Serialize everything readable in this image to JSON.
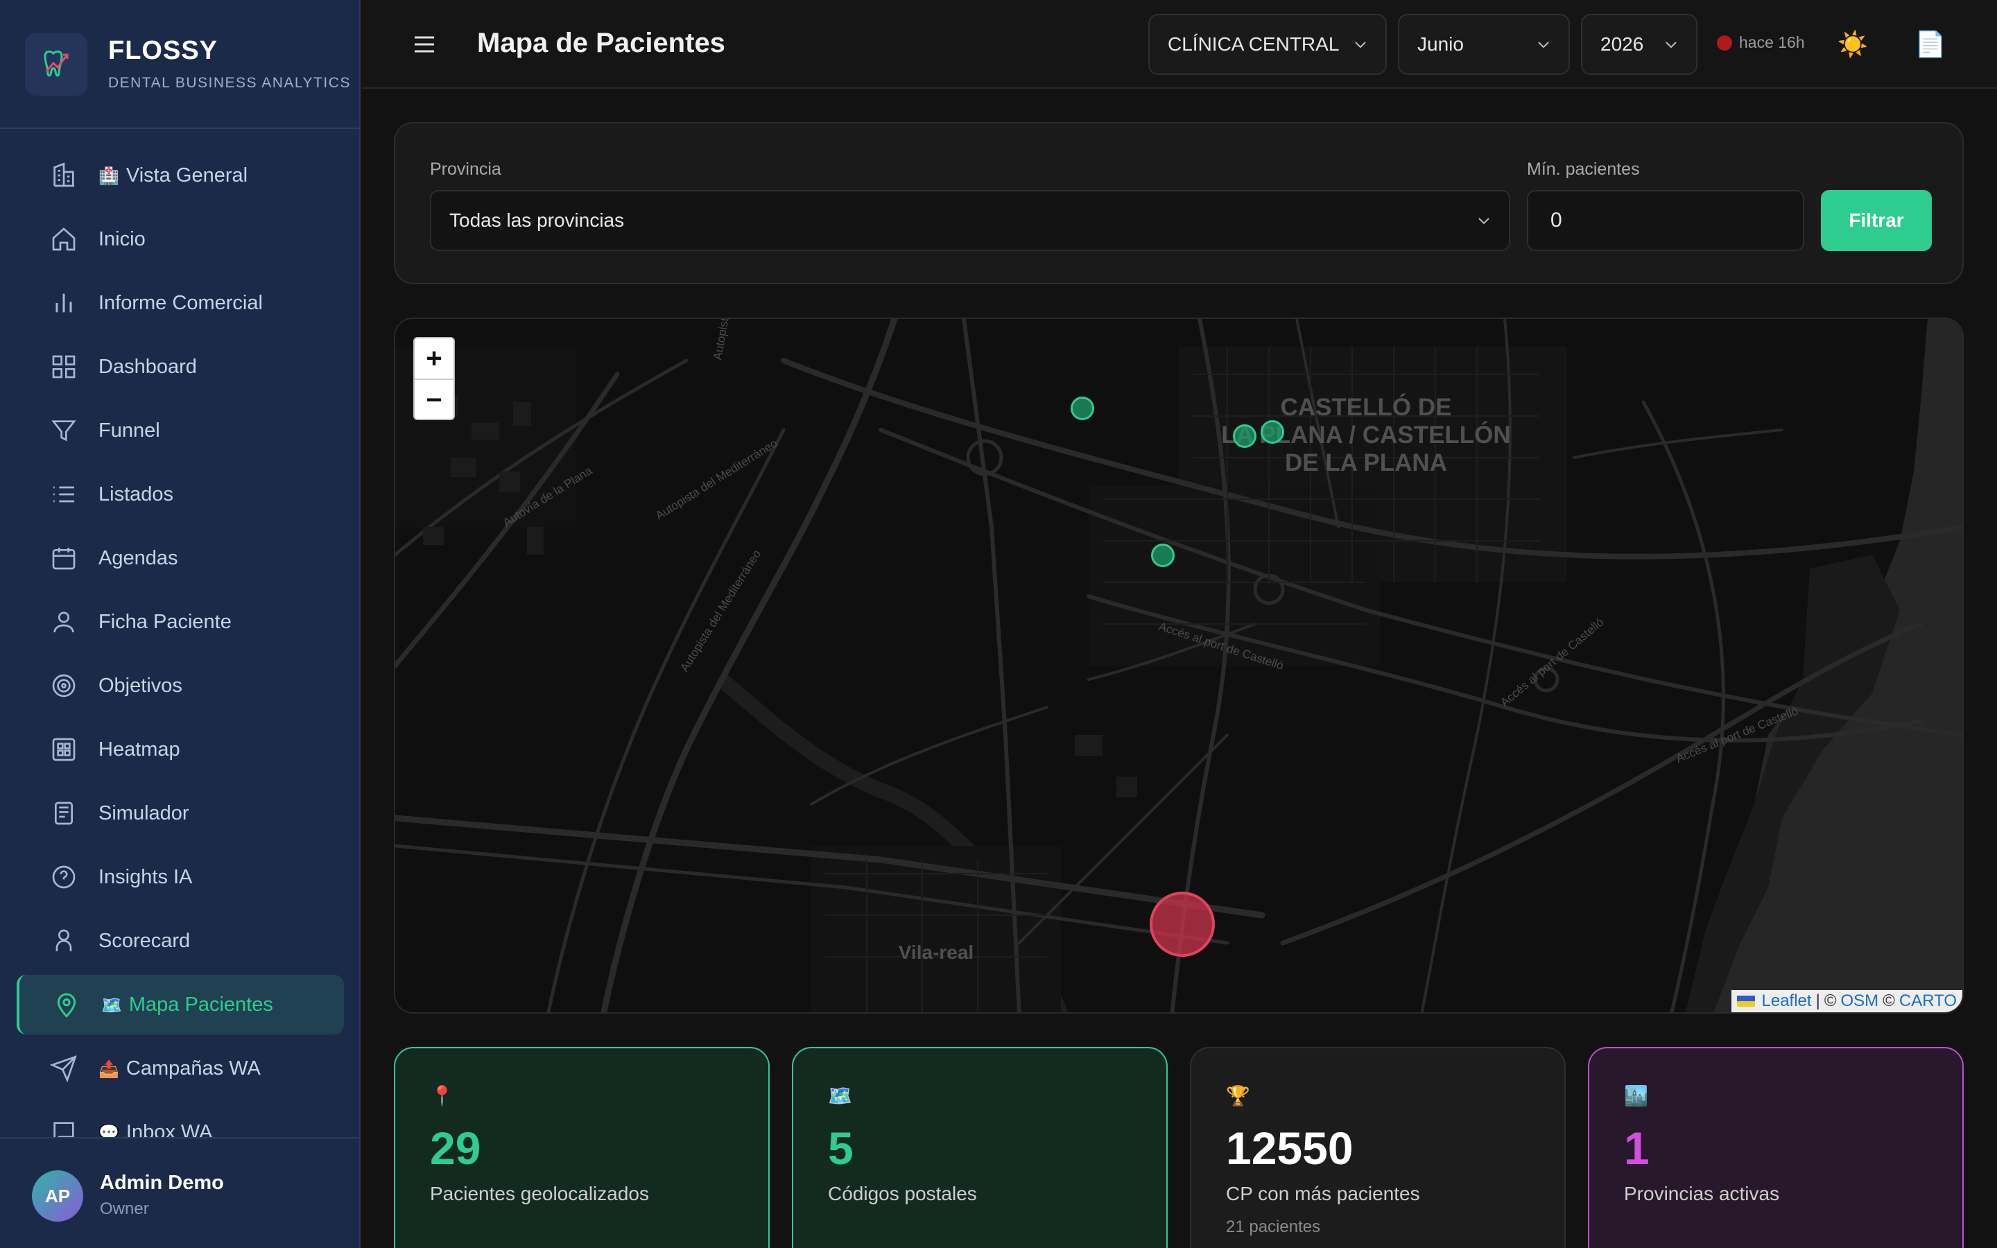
{
  "brand": {
    "name": "FLOSSY",
    "subtitle": "DENTAL BUSINESS ANALYTICS"
  },
  "sidebar": {
    "items": [
      {
        "label": "Vista General",
        "emoji": "🏥",
        "icon": "building-icon"
      },
      {
        "label": "Inicio",
        "icon": "home-icon"
      },
      {
        "label": "Informe Comercial",
        "icon": "bar-chart-icon"
      },
      {
        "label": "Dashboard",
        "icon": "grid-icon"
      },
      {
        "label": "Funnel",
        "icon": "filter-icon"
      },
      {
        "label": "Listados",
        "icon": "list-icon"
      },
      {
        "label": "Agendas",
        "icon": "calendar-icon"
      },
      {
        "label": "Ficha Paciente",
        "icon": "user-icon"
      },
      {
        "label": "Objetivos",
        "icon": "target-icon"
      },
      {
        "label": "Heatmap",
        "icon": "heatmap-icon"
      },
      {
        "label": "Simulador",
        "icon": "calculator-icon"
      },
      {
        "label": "Insights IA",
        "icon": "help-circle-icon"
      },
      {
        "label": "Scorecard",
        "icon": "user-badge-icon"
      },
      {
        "label": "Mapa Pacientes",
        "emoji": "🗺️",
        "icon": "map-pin-icon",
        "active": true
      },
      {
        "label": "Campañas WA",
        "emoji": "📤",
        "icon": "send-icon"
      },
      {
        "label": "Inbox WA",
        "emoji": "💬",
        "icon": "message-icon"
      }
    ]
  },
  "user": {
    "initials": "AP",
    "name": "Admin Demo",
    "role": "Owner"
  },
  "header": {
    "title": "Mapa de Pacientes",
    "clinic": "CLÍNICA CENTRAL",
    "month": "Junio",
    "year": "2026",
    "sync_status": "hace 16h",
    "theme_icon": "☀️",
    "report_icon": "📄"
  },
  "filters": {
    "province_label": "Provincia",
    "province_value": "Todas las provincias",
    "min_label": "Mín. pacientes",
    "min_value": "0",
    "submit_label": "Filtrar"
  },
  "map": {
    "zoom_in": "+",
    "zoom_out": "−",
    "city_main": "CASTELLÓ DE LA PLANA / CASTELLÓN DE LA PLANA",
    "city_main_lines": [
      "CASTELLÓ DE",
      "LA PLANA / CASTELLÓN",
      "DE LA PLANA"
    ],
    "city_secondary": "Vila-real",
    "road_labels": [
      "Autovía de la Plana",
      "Autopista del Mediterráneo",
      "Autopista del Mediterráneo",
      "Accés al port de Castelló",
      "Accés al port de Castelló",
      "Accés al port de Castelló",
      "Autopista"
    ],
    "attribution": {
      "leaflet": "Leaflet",
      "sep": "|",
      "osm_prefix": "©",
      "osm": "OSM",
      "carto_prefix": "©",
      "carto": "CARTO"
    },
    "colors": {
      "small_marker": "#1f9e6a",
      "large_marker": "#d1344d"
    }
  },
  "stats": [
    {
      "icon": "📍",
      "value": "29",
      "label": "Pacientes geolocalizados",
      "sub": "",
      "color": "#2ecc8f"
    },
    {
      "icon": "🗺️",
      "value": "5",
      "label": "Códigos postales",
      "sub": "",
      "color": "#2ecc8f"
    },
    {
      "icon": "🏆",
      "value": "12550",
      "label": "CP con más pacientes",
      "sub": "21 pacientes",
      "color": "#ffffff"
    },
    {
      "icon": "🏙️",
      "value": "1",
      "label": "Provincias activas",
      "sub": "",
      "color": "#d14fdc"
    }
  ]
}
